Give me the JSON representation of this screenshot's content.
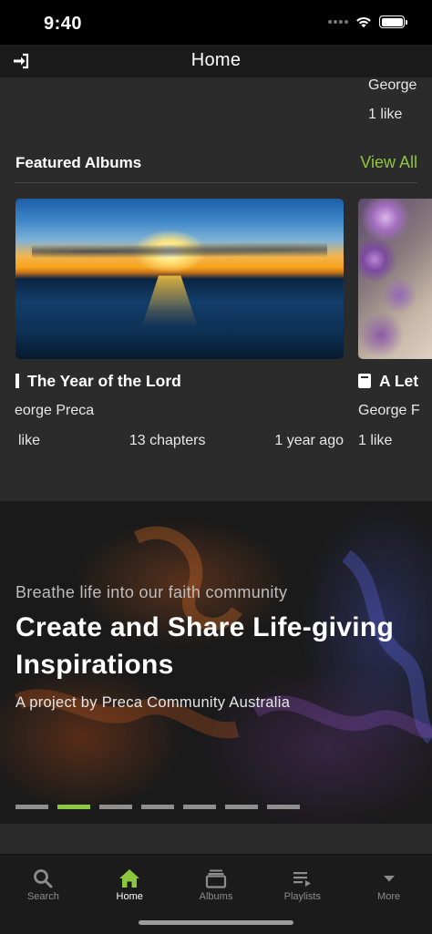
{
  "status_bar": {
    "time": "9:40"
  },
  "header": {
    "title": "Home",
    "login_icon": "login-icon"
  },
  "previous_item": {
    "author": "George",
    "likes": "1 like"
  },
  "featured": {
    "title": "Featured Albums",
    "view_all": "View All",
    "albums": [
      {
        "title": "The Year of the Lord",
        "author": "eorge Preca",
        "likes": "like",
        "chapters": "13 chapters",
        "age": "1 year ago",
        "icon": "book-icon"
      },
      {
        "title": "A Let",
        "author": "George F",
        "likes": "1 like",
        "icon": "book-icon"
      }
    ]
  },
  "banner": {
    "kicker": "Breathe life into our faith community",
    "heading": "Create and Share Life-giving Inspirations",
    "subtitle": "A project by Preca Community Australia",
    "pager": {
      "count": 7,
      "active_index": 1
    }
  },
  "tabs": [
    {
      "label": "Search",
      "icon": "search-icon",
      "active": false
    },
    {
      "label": "Home",
      "icon": "home-icon",
      "active": true
    },
    {
      "label": "Albums",
      "icon": "albums-icon",
      "active": false
    },
    {
      "label": "Playlists",
      "icon": "playlists-icon",
      "active": false
    },
    {
      "label": "More",
      "icon": "chevron-down-icon",
      "active": false
    }
  ],
  "colors": {
    "accent": "#8dc63f",
    "background": "#2b2b2b",
    "header": "#1b1b1b"
  }
}
